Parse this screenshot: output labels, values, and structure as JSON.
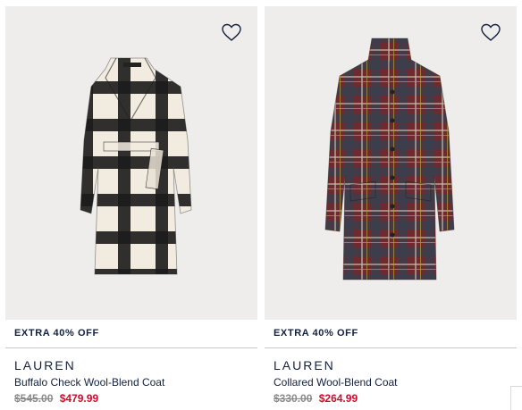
{
  "products": [
    {
      "promo": "EXTRA 40% OFF",
      "brand": "LAUREN",
      "name": "Buffalo Check Wool-Blend Coat",
      "original_price": "$545.00",
      "sale_price": "$479.99",
      "wishlist_icon": "heart-outline-icon",
      "image": "buffalo-check-coat"
    },
    {
      "promo": "EXTRA 40% OFF",
      "brand": "LAUREN",
      "name": "Collared Wool-Blend Coat",
      "original_price": "$330.00",
      "sale_price": "$264.99",
      "wishlist_icon": "heart-outline-icon",
      "image": "plaid-collared-coat"
    }
  ],
  "colors": {
    "text_navy": "#13213f",
    "sale_red": "#c8102e",
    "strike_gray": "#8a8a8a",
    "image_bg": "#efedeb"
  }
}
